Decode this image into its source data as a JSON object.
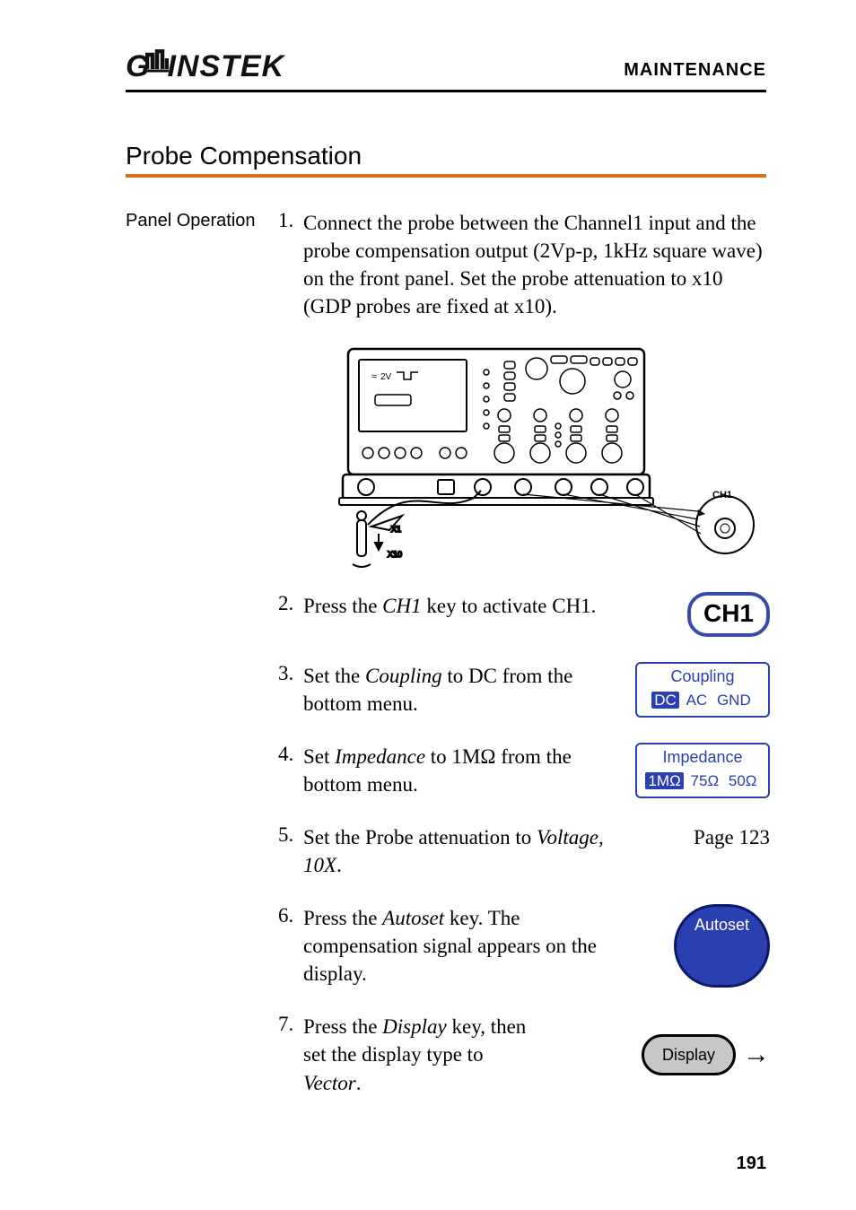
{
  "header": {
    "right": "MAINTENANCE"
  },
  "section_title": "Probe Compensation",
  "side_label": "Panel Operation",
  "steps": {
    "s1": {
      "num": "1.",
      "text_a": "Connect the probe between the Channel1 input and the probe compensation output (2Vp-p, 1kHz square wave) on the front panel. Set the probe attenuation to x10 (GDP probes are fixed at x10)."
    },
    "s2": {
      "num": "2.",
      "text_a": "Press the ",
      "em": "CH1",
      "text_b": " key to activate CH1.",
      "key": "CH1"
    },
    "s3": {
      "num": "3.",
      "text_a": "Set the ",
      "em": "Coupling",
      "text_b": " to DC from the bottom menu.",
      "sk_title": "Coupling",
      "sk_sel": "DC",
      "sk_u1": "AC",
      "sk_u2": "GND"
    },
    "s4": {
      "num": "4.",
      "text_a": "Set ",
      "em": "Impedance",
      "text_b": " to 1MΩ from the bottom menu.",
      "sk_title": "Impedance",
      "sk_sel": "1MΩ",
      "sk_u1": "75Ω",
      "sk_u2": "50Ω"
    },
    "s5": {
      "num": "5.",
      "text_a": "Set the Probe attenuation to ",
      "em": "Voltage, 10X",
      "text_b": ".",
      "ref": "Page 123"
    },
    "s6": {
      "num": "6.",
      "text_a": "Press the ",
      "em": "Autoset",
      "text_b": " key. The compensation signal appears on the display.",
      "btn": "Autoset"
    },
    "s7": {
      "num": "7.",
      "text_a": "Press the ",
      "em": "Display",
      "text_b": " key, then set the display type to ",
      "em2": "Vector",
      "text_c": ".",
      "btn": "Display"
    }
  },
  "diagram": {
    "sq_label": "2V",
    "x1": "X1",
    "x10": "X10",
    "ch1": "CH1"
  },
  "page_number": "191"
}
